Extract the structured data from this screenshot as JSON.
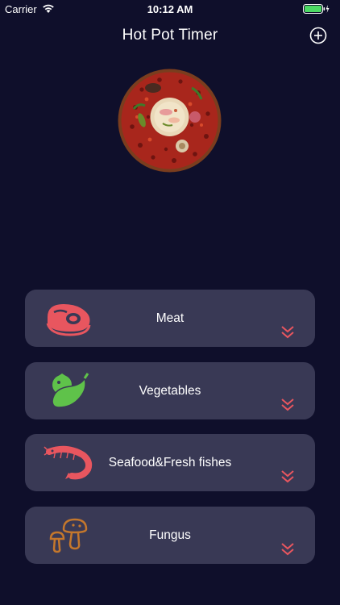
{
  "status": {
    "carrier": "Carrier",
    "time": "10:12 AM"
  },
  "nav": {
    "title": "Hot Pot Timer"
  },
  "categories": [
    {
      "label": "Meat",
      "icon": "meat-icon",
      "color": "#e8565f"
    },
    {
      "label": "Vegetables",
      "icon": "vegetables-icon",
      "color": "#5fc24a"
    },
    {
      "label": "Seafood&Fresh fishes",
      "icon": "shrimp-icon",
      "color": "#e8565f"
    },
    {
      "label": "Fungus",
      "icon": "mushroom-icon",
      "color": "#c4772c"
    }
  ],
  "colors": {
    "background": "#0f0f2b",
    "card": "#393955",
    "chevron": "#e8565f"
  }
}
